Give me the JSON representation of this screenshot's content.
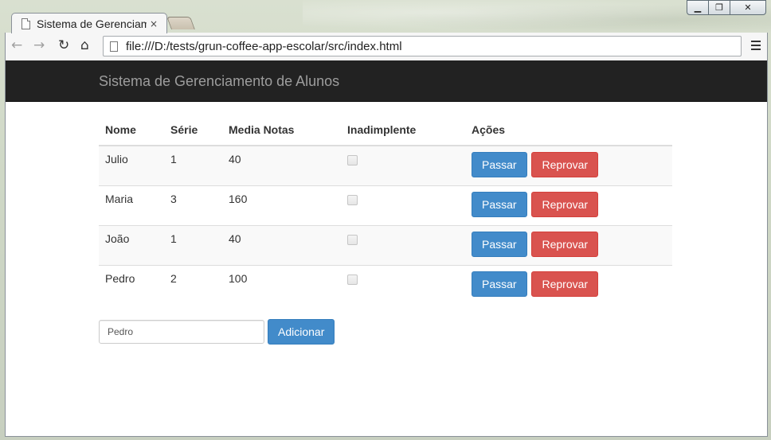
{
  "browser": {
    "tab_title": "Sistema de Gerenciamento de Alunos",
    "tab_close": "×",
    "url": "file:///D:/tests/grun-coffee-app-escolar/src/index.html",
    "window_controls": [
      "minimize-icon",
      "maximize-icon",
      "close-icon"
    ]
  },
  "navbar": {
    "brand": "Sistema de Gerenciamento de Alunos"
  },
  "table": {
    "headers": [
      "Nome",
      "Série",
      "Media Notas",
      "Inadimplente",
      "Ações"
    ],
    "rows": [
      {
        "nome": "Julio",
        "serie": "1",
        "media": "40",
        "inadimplente": false
      },
      {
        "nome": "Maria",
        "serie": "3",
        "media": "160",
        "inadimplente": false
      },
      {
        "nome": "João",
        "serie": "1",
        "media": "40",
        "inadimplente": false
      },
      {
        "nome": "Pedro",
        "serie": "2",
        "media": "100",
        "inadimplente": false
      }
    ],
    "pass_label": "Passar",
    "fail_label": "Reprovar"
  },
  "form": {
    "input_value": "Pedro",
    "add_label": "Adicionar"
  },
  "colors": {
    "navbar": "#222222",
    "primary": "#428bca",
    "danger": "#d9534f"
  }
}
